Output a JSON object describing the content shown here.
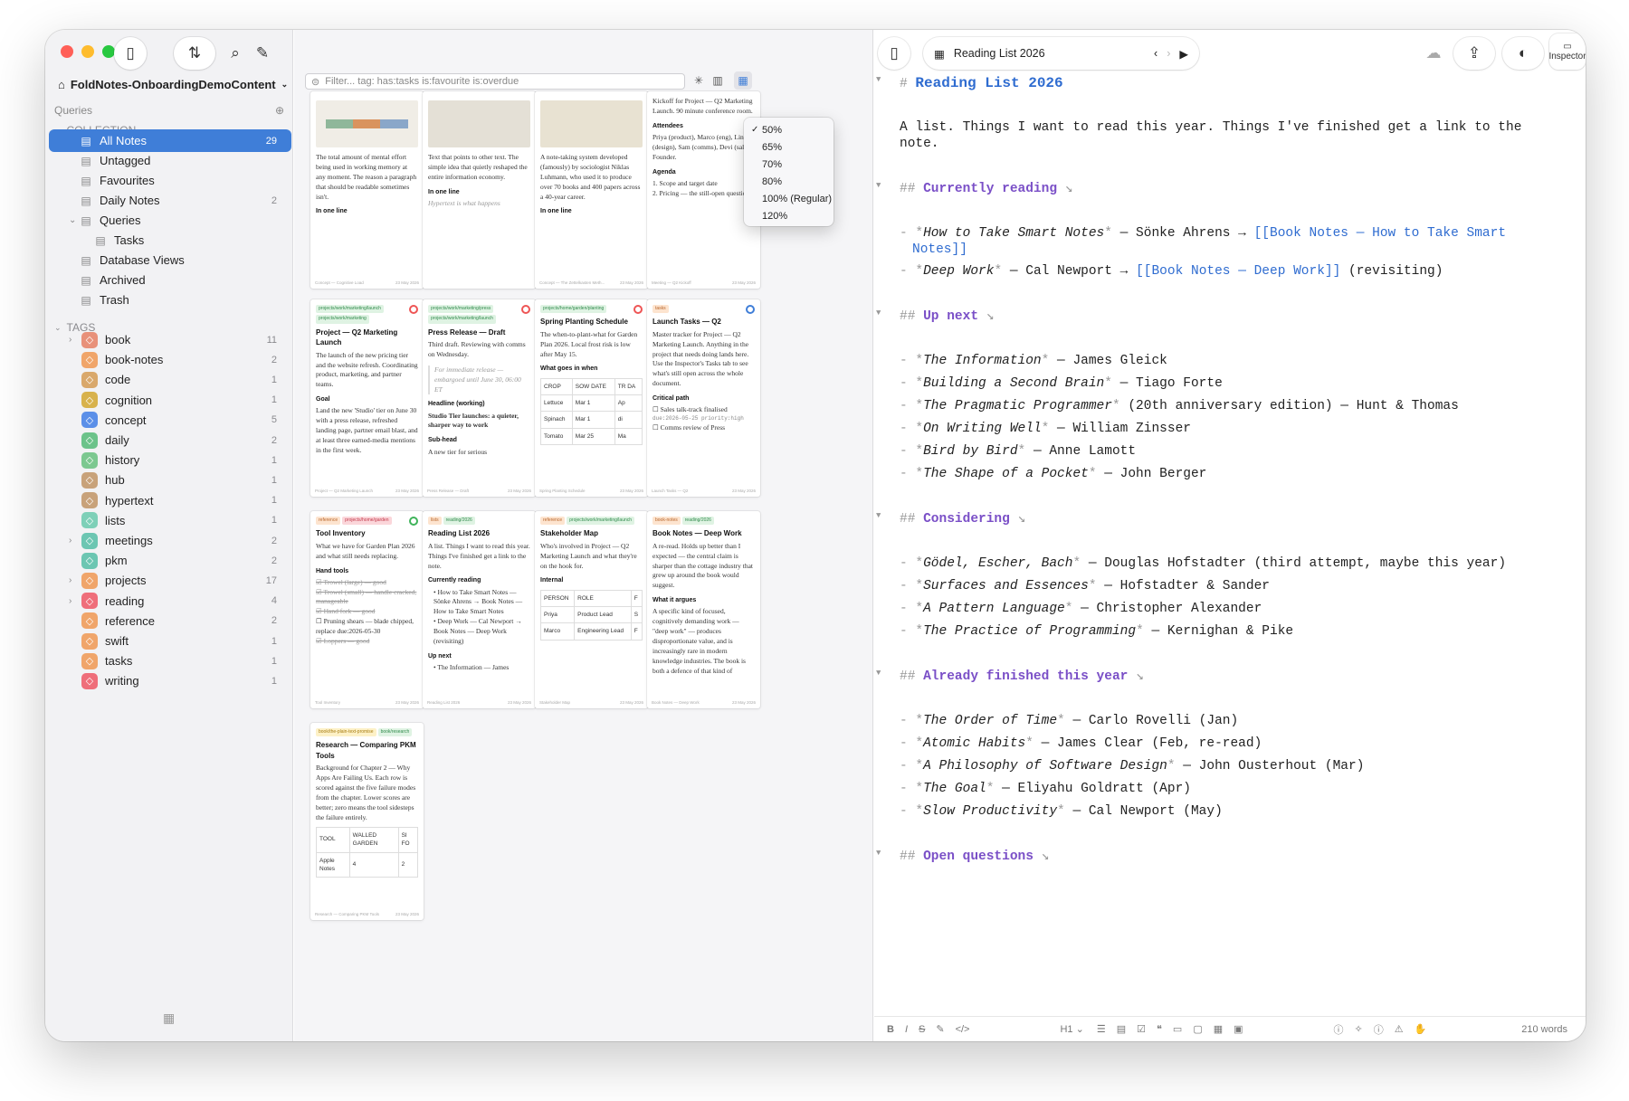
{
  "workspace": "FoldNotes-OnboardingDemoContent",
  "queries_label": "Queries",
  "collection_label": "COLLECTION",
  "tags_label": "TAGS",
  "collection": [
    {
      "label": "All Notes",
      "count": "29",
      "icon": "notes-icon",
      "selected": true
    },
    {
      "label": "Untagged",
      "count": "",
      "icon": "untagged-icon"
    },
    {
      "label": "Favourites",
      "count": "",
      "icon": "star-icon"
    },
    {
      "label": "Daily Notes",
      "count": "2",
      "icon": "calendar-icon"
    },
    {
      "label": "Queries",
      "count": "",
      "icon": "query-icon"
    },
    {
      "label": "Tasks",
      "count": "",
      "icon": "search-icon"
    },
    {
      "label": "Database Views",
      "count": "",
      "icon": "table-icon"
    },
    {
      "label": "Archived",
      "count": "",
      "icon": "archive-icon"
    },
    {
      "label": "Trash",
      "count": "",
      "icon": "trash-icon"
    }
  ],
  "tags": [
    {
      "label": "book",
      "count": "11",
      "color": "#e8917a",
      "chev": true
    },
    {
      "label": "book-notes",
      "count": "2",
      "color": "#f0a56a"
    },
    {
      "label": "code",
      "count": "1",
      "color": "#d9a86b"
    },
    {
      "label": "cognition",
      "count": "1",
      "color": "#d8b24c"
    },
    {
      "label": "concept",
      "count": "5",
      "color": "#5b8fe8"
    },
    {
      "label": "daily",
      "count": "2",
      "color": "#6cc38a"
    },
    {
      "label": "history",
      "count": "1",
      "color": "#7cc890"
    },
    {
      "label": "hub",
      "count": "1",
      "color": "#c8a27a"
    },
    {
      "label": "hypertext",
      "count": "1",
      "color": "#c8a27a"
    },
    {
      "label": "lists",
      "count": "1",
      "color": "#7ed0b8"
    },
    {
      "label": "meetings",
      "count": "2",
      "color": "#6cc6b2",
      "chev": true
    },
    {
      "label": "pkm",
      "count": "2",
      "color": "#6cc6b2"
    },
    {
      "label": "projects",
      "count": "17",
      "color": "#f0a56a",
      "chev": true
    },
    {
      "label": "reading",
      "count": "4",
      "color": "#ef6e7a",
      "chev": true
    },
    {
      "label": "reference",
      "count": "2",
      "color": "#f0a56a"
    },
    {
      "label": "swift",
      "count": "1",
      "color": "#f0a56a"
    },
    {
      "label": "tasks",
      "count": "1",
      "color": "#f0a56a"
    },
    {
      "label": "writing",
      "count": "1",
      "color": "#ef6e7a"
    }
  ],
  "filter_placeholder": "Filter...  tag:  has:tasks  is:favourite  is:overdue",
  "zoom_options": [
    {
      "label": "50%",
      "checked": true
    },
    {
      "label": "65%"
    },
    {
      "label": "70%"
    },
    {
      "label": "80%"
    },
    {
      "label": "100% (Regular)"
    },
    {
      "label": "120%"
    }
  ],
  "note_tab": "Reading List 2026",
  "inspector_label": "Inspector",
  "word_count": "210 words",
  "heading_level": "H1",
  "cards": {
    "c1_body": "The total amount of mental effort being used in working memory at any moment. The reason a paragraph that should be readable sometimes isn't.",
    "c1_h": "In one line",
    "c1_ft": "Concept — Cognitive Load",
    "c2_body": "Text that points to other text. The simple idea that quietly reshaped the entire information economy.",
    "c2_h": "In one line",
    "c2_more": "Hypertext is what happens",
    "c3_body": "A note-taking system developed (famously) by sociologist Niklas Luhmann, who used it to produce over 70 books and 400 papers across a 40-year career.",
    "c3_h": "In one line",
    "c3_ft": "Concept — The Zettelkasten Meth...",
    "c4_body": "Kickoff for Project — Q2 Marketing Launch. 90 minute conference room.",
    "c4_h1": "Attendees",
    "c4_att": "Priya (product), Marco (eng), Lin (design), Sam (comms), Devi (sales). Founder.",
    "c4_h2": "Agenda",
    "c4_a1": "1. Scope and target date",
    "c4_a2": "2. Pricing — the still-open questions",
    "c4_ft": "Meeting — Q2 Kickoff",
    "c5_tag1": "projects/work/marketing/launch",
    "c5_tag2": "projects/work/marketing",
    "c5_title": "Project — Q2 Marketing Launch",
    "c5_body": "The launch of the new pricing tier and the website refresh. Coordinating product, marketing, and partner teams.",
    "c5_h": "Goal",
    "c5_goal": "Land the new 'Studio' tier on June 30 with a press release, refreshed landing page, partner email blast, and at least three earned-media mentions in the first week.",
    "c5_ft": "Project — Q2 Marketing Launch",
    "c6_tag1": "projects/work/marketing/press",
    "c6_tag2": "projects/work/marketing/launch",
    "c6_title": "Press Release — Draft",
    "c6_body": "Third draft. Reviewing with comms on Wednesday.",
    "c6_quote": "For immediate release — embargoed until June 30, 06:00 ET",
    "c6_h1": "Headline (working)",
    "c6_hl": "Studio Tier launches: a quieter, sharper way to work",
    "c6_h2": "Sub-head",
    "c6_sub": "A new tier for serious",
    "c6_ft": "Press Release — Draft",
    "c7_tag": "projects/home/garden/planting",
    "c7_title": "Spring Planting Schedule",
    "c7_body": "The when-to-plant-what for Garden Plan 2026. Local frost risk is low after May 15.",
    "c7_h": "What goes in when",
    "c7_cols": [
      "CROP",
      "SOW DATE",
      "TR DA"
    ],
    "c7_rows": [
      [
        "Lettuce",
        "Mar 1",
        "Ap"
      ],
      [
        "Spinach",
        "Mar 1",
        "di"
      ],
      [
        "Tomato",
        "Mar 25",
        "Ma"
      ]
    ],
    "c7_ft": "Spring Planting Schedule",
    "c8_tag": "tasks",
    "c8_title": "Launch Tasks — Q2",
    "c8_body": "Master tracker for Project — Q2 Marketing Launch. Anything in the project that needs doing lands here. Use the Inspector's Tasks tab to see what's still open across the whole document.",
    "c8_h": "Critical path",
    "c8_t1": "Sales talk-track finalised",
    "c8_t1m": "due:2026-05-25 priority:high",
    "c8_t2": "Comms review of Press",
    "c8_ft": "Launch Tasks — Q2",
    "c9_tag1": "reference",
    "c9_tag2": "projects/home/garden",
    "c9_title": "Tool Inventory",
    "c9_body": "What we have for Garden Plan 2026 and what still needs replacing.",
    "c9_h": "Hand tools",
    "c9_i1": "Trowel (large) — good",
    "c9_i2": "Trowel (small) — handle cracked, manageable",
    "c9_i3": "Hand fork — good",
    "c9_i4": "Pruning shears — blade chipped, replace due:2026-05-30",
    "c9_i5": "Loppers — good",
    "c9_ft": "Tool Inventory",
    "c10_tag1": "lists",
    "c10_tag2": "reading/2026",
    "c10_title": "Reading List 2026",
    "c10_body": "A list. Things I want to read this year. Things I've finished get a link to the note.",
    "c10_h": "Currently reading",
    "c10_b1": "How to Take Smart Notes — Sönke Ahrens → Book Notes — How to Take Smart Notes",
    "c10_b2": "Deep Work — Cal Newport → Book Notes — Deep Work (revisiting)",
    "c10_h2": "Up next",
    "c10_b3": "The Information — James",
    "c10_ft": "Reading List 2026",
    "c11_tag1": "reference",
    "c11_tag2": "projects/work/marketing/launch",
    "c11_title": "Stakeholder Map",
    "c11_body": "Who's involved in Project — Q2 Marketing Launch and what they're on the hook for.",
    "c11_h": "Internal",
    "c11_cols": [
      "PERSON",
      "ROLE",
      "F"
    ],
    "c11_rows": [
      [
        "Priya",
        "Product Lead",
        "S"
      ],
      [
        "Marco",
        "Engineering Lead",
        "F"
      ]
    ],
    "c11_ft": "Stakeholder Map",
    "c12_tag1": "book-notes",
    "c12_tag2": "reading/2026",
    "c12_title": "Book Notes — Deep Work",
    "c12_body": "A re-read. Holds up better than I expected — the central claim is sharper than the cottage industry that grew up around the book would suggest.",
    "c12_h": "What it argues",
    "c12_arg": "A specific kind of focused, cognitively demanding work — \"deep work\" — produces disproportionate value, and is increasingly rare in modern knowledge industries. The book is both a defence of that kind of",
    "c12_ft": "Book Notes — Deep Work",
    "c13_tag1": "book/the-plain-text-promise",
    "c13_tag2": "book/research",
    "c13_title": "Research — Comparing PKM Tools",
    "c13_body": "Background for Chapter 2 — Why Apps Are Failing Us. Each row is scored against the five failure modes from the chapter. Lower scores are better; zero means the tool sidesteps the failure entirely.",
    "c13_cols": [
      "TOOL",
      "WALLED GARDEN",
      "SI FO"
    ],
    "c13_rows": [
      [
        "Apple Notes",
        "4",
        "2"
      ]
    ],
    "c13_ft": "Research — Comparing PKM Tools",
    "date": "23 May 2026"
  },
  "editor": {
    "title_mark": "#",
    "title": "Reading List 2026",
    "intro1": "A list. Things I want to read this year. Things I've finished get a link to the",
    "intro2": "note.",
    "s1": "Currently reading",
    "s2": "Up next",
    "s3": "Considering",
    "s4": "Already finished this year",
    "s5": "Open questions",
    "cur": [
      {
        "t": "How to Take Smart Notes",
        "a": "— Sönke Ahrens →",
        "l": "[[Book Notes — How to Take Smart",
        "l2": "Notes]]"
      },
      {
        "t": "Deep Work",
        "a": "— Cal Newport →",
        "l": "[[Book Notes — Deep Work]]",
        "x": "(revisiting)"
      }
    ],
    "next": [
      {
        "t": "The Information",
        "a": "— James Gleick"
      },
      {
        "t": "Building a Second Brain",
        "a": "— Tiago Forte"
      },
      {
        "t": "The Pragmatic Programmer",
        "a": "(20th anniversary edition) — Hunt & Thomas"
      },
      {
        "t": "On Writing Well",
        "a": "— William Zinsser"
      },
      {
        "t": "Bird by Bird",
        "a": "— Anne Lamott"
      },
      {
        "t": "The Shape of a Pocket",
        "a": "— John Berger"
      }
    ],
    "consider": [
      {
        "t": "Gödel, Escher, Bach",
        "a": "— Douglas Hofstadter (third attempt, maybe this year)"
      },
      {
        "t": "Surfaces and Essences",
        "a": "— Hofstadter & Sander"
      },
      {
        "t": "A Pattern Language",
        "a": "— Christopher Alexander"
      },
      {
        "t": "The Practice of Programming",
        "a": "— Kernighan & Pike"
      }
    ],
    "finished": [
      {
        "t": "The Order of Time",
        "a": "— Carlo Rovelli (Jan)"
      },
      {
        "t": "Atomic Habits",
        "a": "— James Clear (Feb, re-read)"
      },
      {
        "t": "A Philosophy of Software Design",
        "a": "— John Ousterhout (Mar)"
      },
      {
        "t": "The Goal",
        "a": "— Eliyahu Goldratt (Apr)"
      },
      {
        "t": "Slow Productivity",
        "a": "— Cal Newport (May)"
      }
    ]
  }
}
